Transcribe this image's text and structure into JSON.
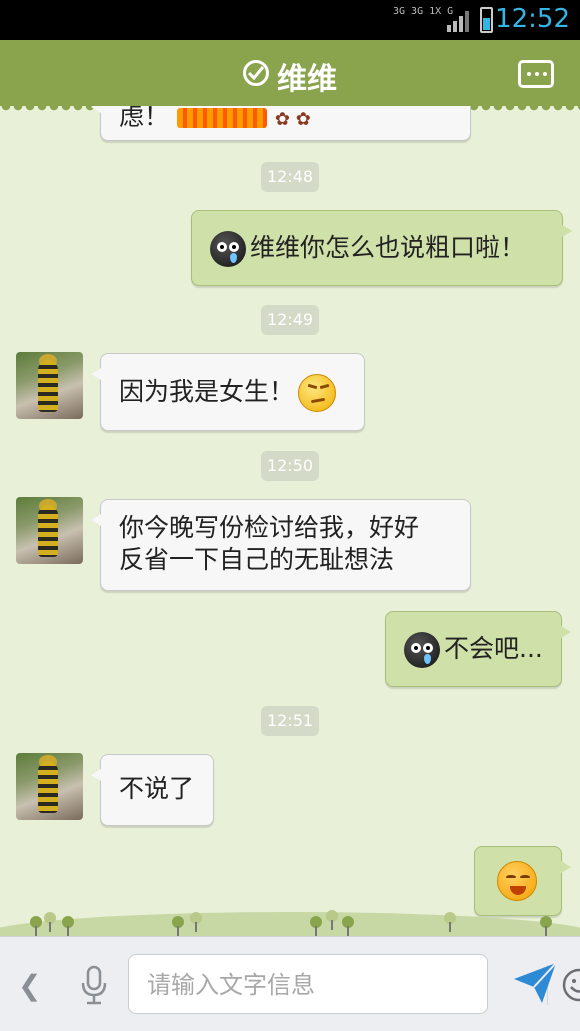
{
  "status_bar": {
    "time": "12:52",
    "network": "3G 3G 1X G"
  },
  "header": {
    "title": "维维"
  },
  "chat": {
    "partial_message": {
      "text": "虑！"
    },
    "timestamps": [
      "12:48",
      "12:49",
      "12:50",
      "12:51"
    ],
    "messages": [
      {
        "from": "me",
        "text": "维维你怎么也说粗口啦！",
        "emoji": "cry-black-face"
      },
      {
        "from": "other",
        "text": "因为我是女生！",
        "emoji": "smirk-face"
      },
      {
        "from": "other",
        "line1": "你今晚写份检讨给我，好好",
        "line2": "反省一下自己的无耻想法"
      },
      {
        "from": "me",
        "text": "不会吧...",
        "emoji": "cry-black-face"
      },
      {
        "from": "other",
        "text": "不说了"
      },
      {
        "from": "me",
        "text": "",
        "emoji": "crying-laugh-face"
      }
    ]
  },
  "input_bar": {
    "placeholder": "请输入文字信息",
    "value": ""
  },
  "colors": {
    "header": "#8aa44e",
    "background": "#e8f0d8",
    "bubble_out": "#cfe0a8",
    "bubble_in": "#f7f7f7",
    "accent": "#33b5e5"
  }
}
